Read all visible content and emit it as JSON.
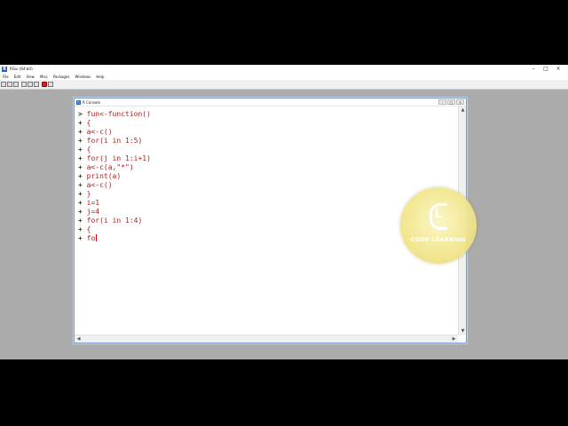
{
  "rgui": {
    "title": "RGui (64-bit)",
    "menu": [
      "File",
      "Edit",
      "View",
      "Misc",
      "Packages",
      "Windows",
      "Help"
    ],
    "window_controls": {
      "minimize": "–",
      "maximize": "□",
      "close": "×"
    },
    "toolbar_icons": [
      "open-script-icon",
      "load-workspace-icon",
      "save-workspace-icon",
      "copy-icon",
      "paste-icon",
      "copy-paste-icon",
      "stop-icon",
      "print-icon"
    ]
  },
  "console": {
    "title": "R Console",
    "lines": [
      {
        "prompt": ">",
        "code": "fun<-function()"
      },
      {
        "prompt": "+",
        "code": "{"
      },
      {
        "prompt": "+",
        "code": "a<-c()"
      },
      {
        "prompt": "+",
        "code": "for(i in 1:5)"
      },
      {
        "prompt": "+",
        "code": "{"
      },
      {
        "prompt": "+",
        "code": "for(j in 1:i+1)"
      },
      {
        "prompt": "+",
        "code": "a<-c(a,\"*\")"
      },
      {
        "prompt": "+",
        "code": "print(a)"
      },
      {
        "prompt": "+",
        "code": "a<-c()"
      },
      {
        "prompt": "+",
        "code": "}"
      },
      {
        "prompt": "+",
        "code": "i=1"
      },
      {
        "prompt": "+",
        "code": "j=4"
      },
      {
        "prompt": "+",
        "code": "for(i in 1:4)"
      },
      {
        "prompt": "+",
        "code": "{"
      },
      {
        "prompt": "+",
        "code": "fo"
      }
    ]
  },
  "watermark": {
    "letter": "L",
    "text": "CODE LEARNING"
  }
}
